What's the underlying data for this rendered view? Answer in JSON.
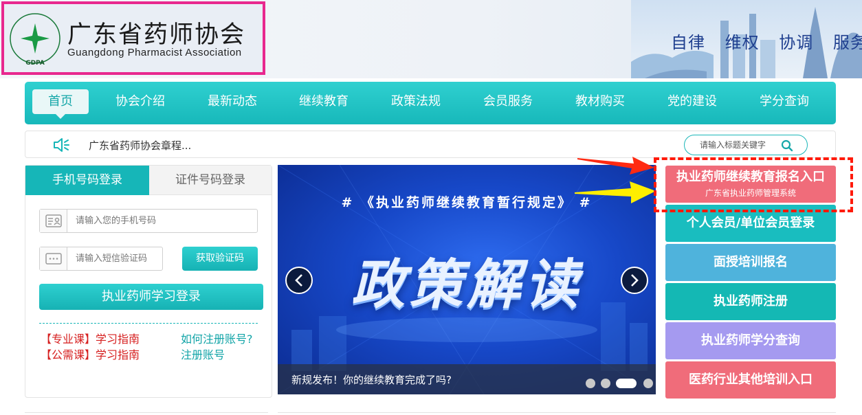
{
  "header": {
    "logo_cn": "广东省药师协会",
    "logo_en": "Guangdong Pharmacist Association",
    "emblem_text": "GDPA",
    "slogans": [
      "自律",
      "维权",
      "协调",
      "服务"
    ]
  },
  "nav": {
    "items": [
      "首页",
      "协会介绍",
      "最新动态",
      "继续教育",
      "政策法规",
      "会员服务",
      "教材购买",
      "党的建设",
      "学分查询"
    ],
    "active_index": 0
  },
  "notice": {
    "icon": "speaker-icon",
    "text": "广东省药师协会章程...",
    "search_placeholder": "请输入标题关键字"
  },
  "login": {
    "tabs": [
      "手机号码登录",
      "证件号码登录"
    ],
    "active_tab": 0,
    "phone_placeholder": "请输入您的手机号码",
    "sms_placeholder": "请输入短信验证码",
    "get_code": "获取验证码",
    "login_button": "执业药师学习登录",
    "guides": [
      {
        "tag": "【专业课】",
        "text": "学习指南"
      },
      {
        "tag": "【公需课】",
        "text": "学习指南"
      }
    ],
    "help_links": [
      "如何注册账号?",
      "注册账号"
    ]
  },
  "banner": {
    "heading": "#  《执业药师继续教育暂行规定》  #",
    "main": "政策解读",
    "caption": "新规发布！你的继续教育完成了吗?",
    "slide_count": 4,
    "active_slide": 2
  },
  "quick_links": [
    {
      "label": "执业药师继续教育报名入口",
      "sub": "广东省执业药师管理系统",
      "color": "#f06c7a"
    },
    {
      "label": "个人会员/单位会员登录",
      "color": "#19bdbf"
    },
    {
      "label": "面授培训报名",
      "color": "#4fb3dc"
    },
    {
      "label": "执业药师注册",
      "color": "#14b8b4"
    },
    {
      "label": "执业药师学分查询",
      "color": "#a59af0"
    },
    {
      "label": "医药行业其他培训入口",
      "color": "#f06c7a"
    }
  ],
  "colors": {
    "accent": "#16b6b8",
    "highlight_border": "#e8288e",
    "dashed_annotation": "#ff1a0a",
    "link_red": "#d61f1f"
  }
}
